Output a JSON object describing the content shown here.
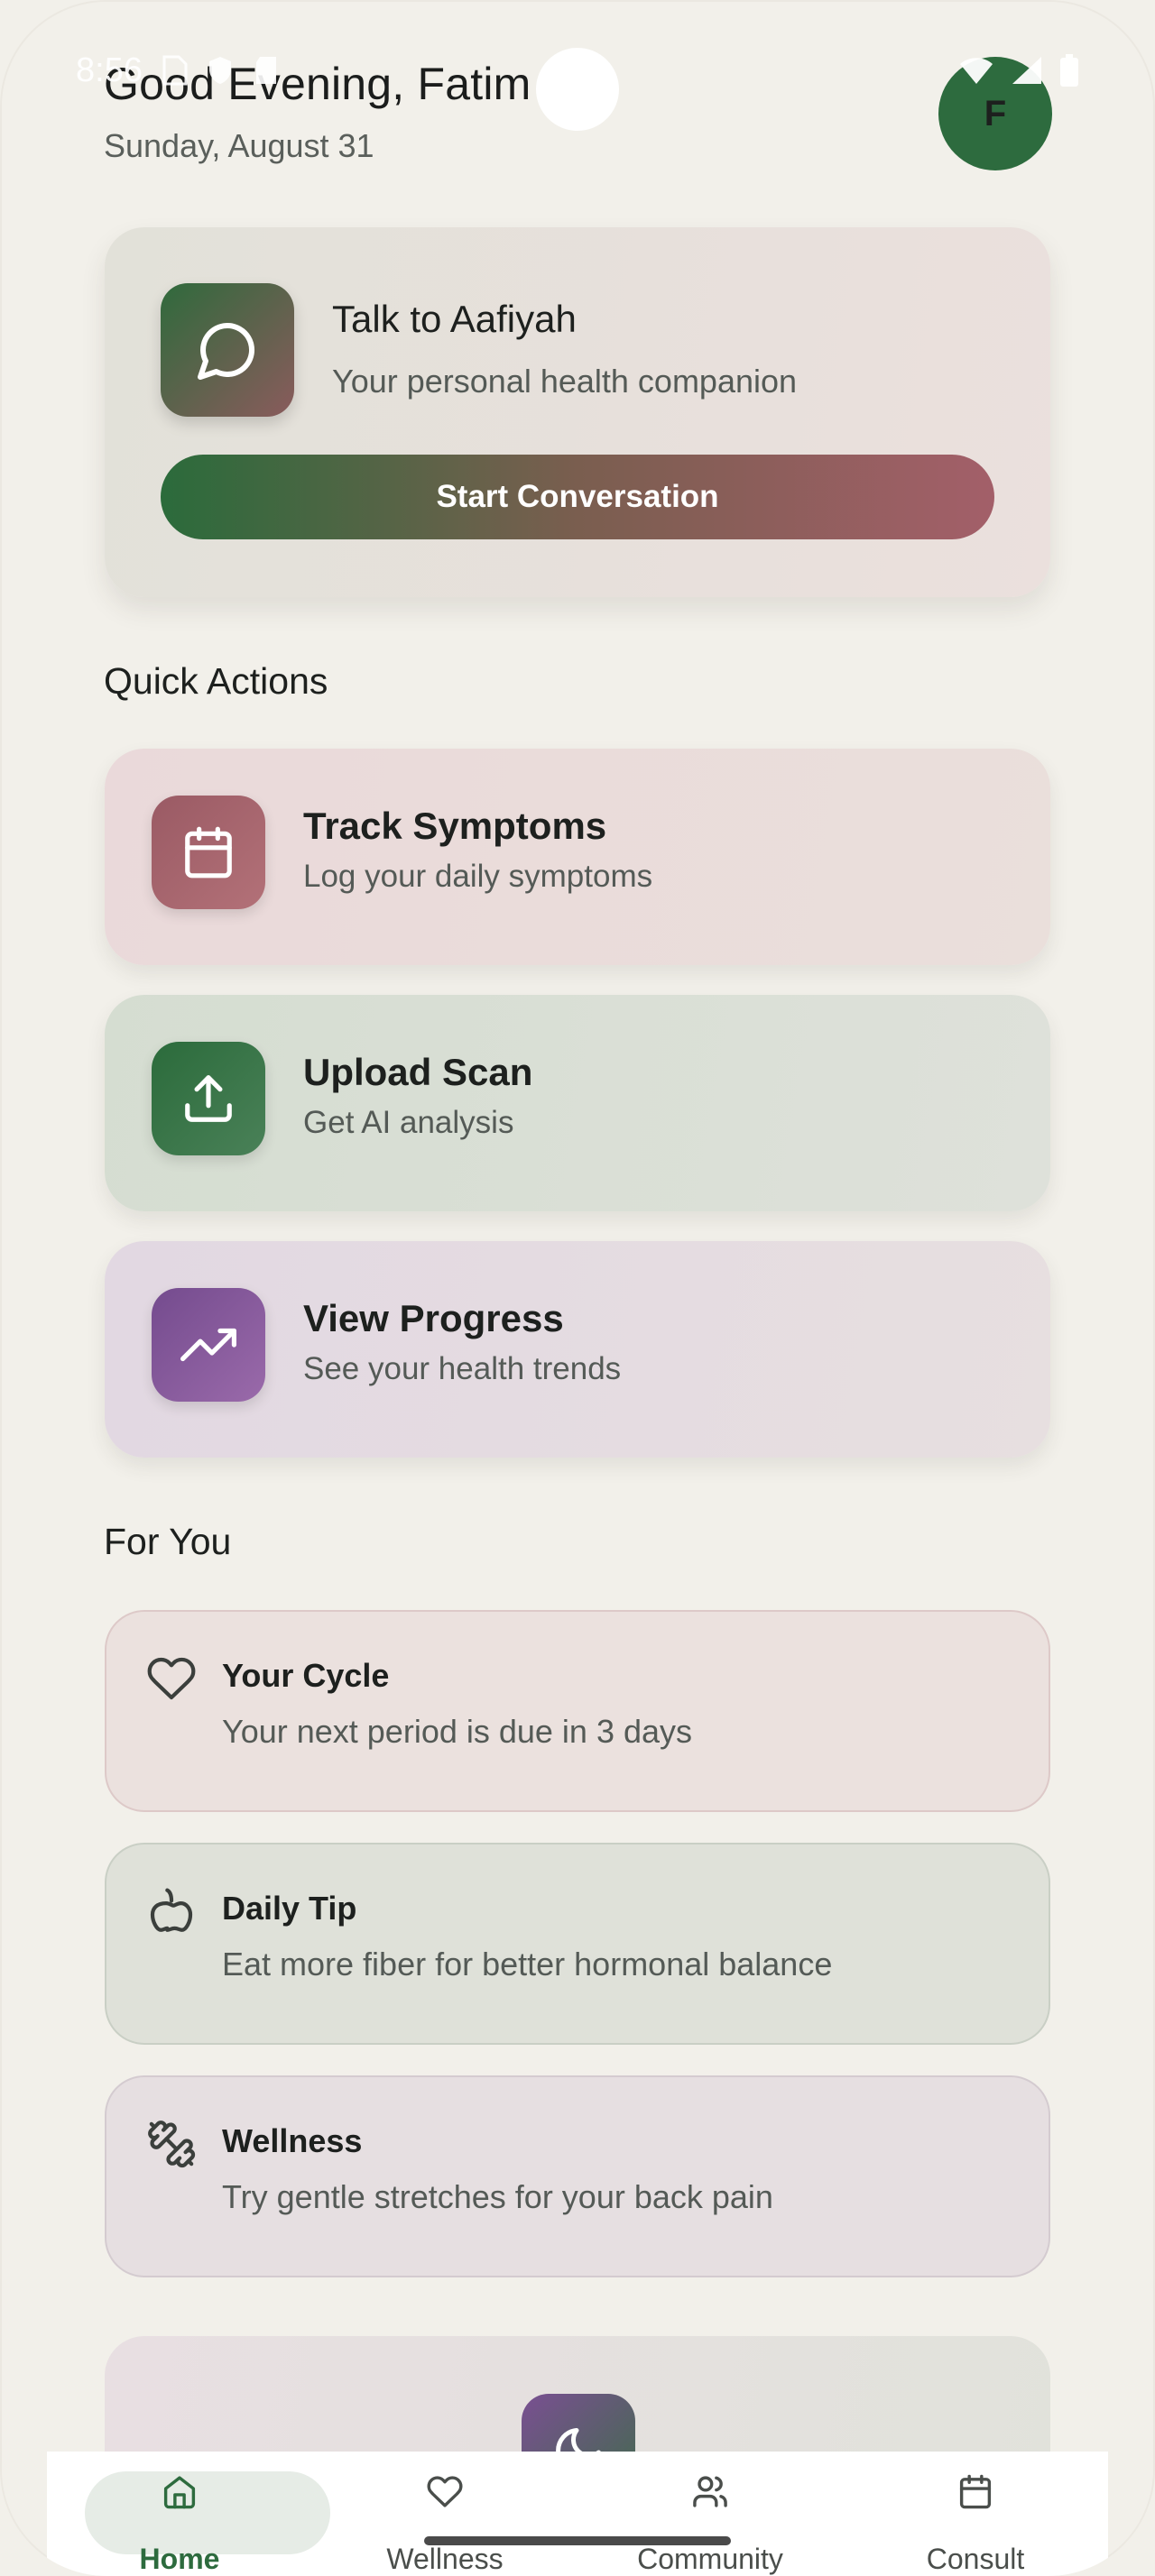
{
  "status_bar": {
    "time": "8:56",
    "icons": [
      "sim-icon",
      "shield-icon",
      "sd-card-icon",
      "wifi-icon",
      "signal-icon",
      "battery-icon"
    ]
  },
  "header": {
    "greeting": "Good Evening, Fatim",
    "date": "Sunday, August 31",
    "avatar_initial": "F"
  },
  "assistant_card": {
    "title": "Talk to Aafiyah",
    "subtitle": "Your personal health companion",
    "button_label": "Start Conversation",
    "icon": "chat-bubble-icon"
  },
  "quick_actions": {
    "title": "Quick Actions",
    "items": [
      {
        "title": "Track Symptoms",
        "subtitle": "Log your daily symptoms",
        "icon": "calendar-icon",
        "color": "#9a5a64"
      },
      {
        "title": "Upload Scan",
        "subtitle": "Get AI analysis",
        "icon": "upload-icon",
        "color": "#2f6a3c"
      },
      {
        "title": "View Progress",
        "subtitle": "See your health trends",
        "icon": "trending-up-icon",
        "color": "#7b4f92"
      }
    ]
  },
  "for_you": {
    "title": "For You",
    "items": [
      {
        "title": "Your Cycle",
        "subtitle": "Your next period is due in 3 days",
        "icon": "heart-icon"
      },
      {
        "title": "Daily Tip",
        "subtitle": "Eat more fiber for better hormonal balance",
        "icon": "apple-icon"
      },
      {
        "title": "Wellness",
        "subtitle": "Try gentle stretches for your back pain",
        "icon": "dumbbell-icon"
      }
    ]
  },
  "bottom_nav": {
    "items": [
      {
        "label": "Home",
        "icon": "home-icon",
        "active": true
      },
      {
        "label": "Wellness",
        "icon": "heart-icon",
        "active": false
      },
      {
        "label": "Community",
        "icon": "users-icon",
        "active": false
      },
      {
        "label": "Consult",
        "icon": "calendar-icon",
        "active": false
      }
    ]
  },
  "colors": {
    "background": "#f2f0ea",
    "primary_green": "#2d6b3e",
    "rose": "#a35f69",
    "purple": "#7b4f92"
  }
}
